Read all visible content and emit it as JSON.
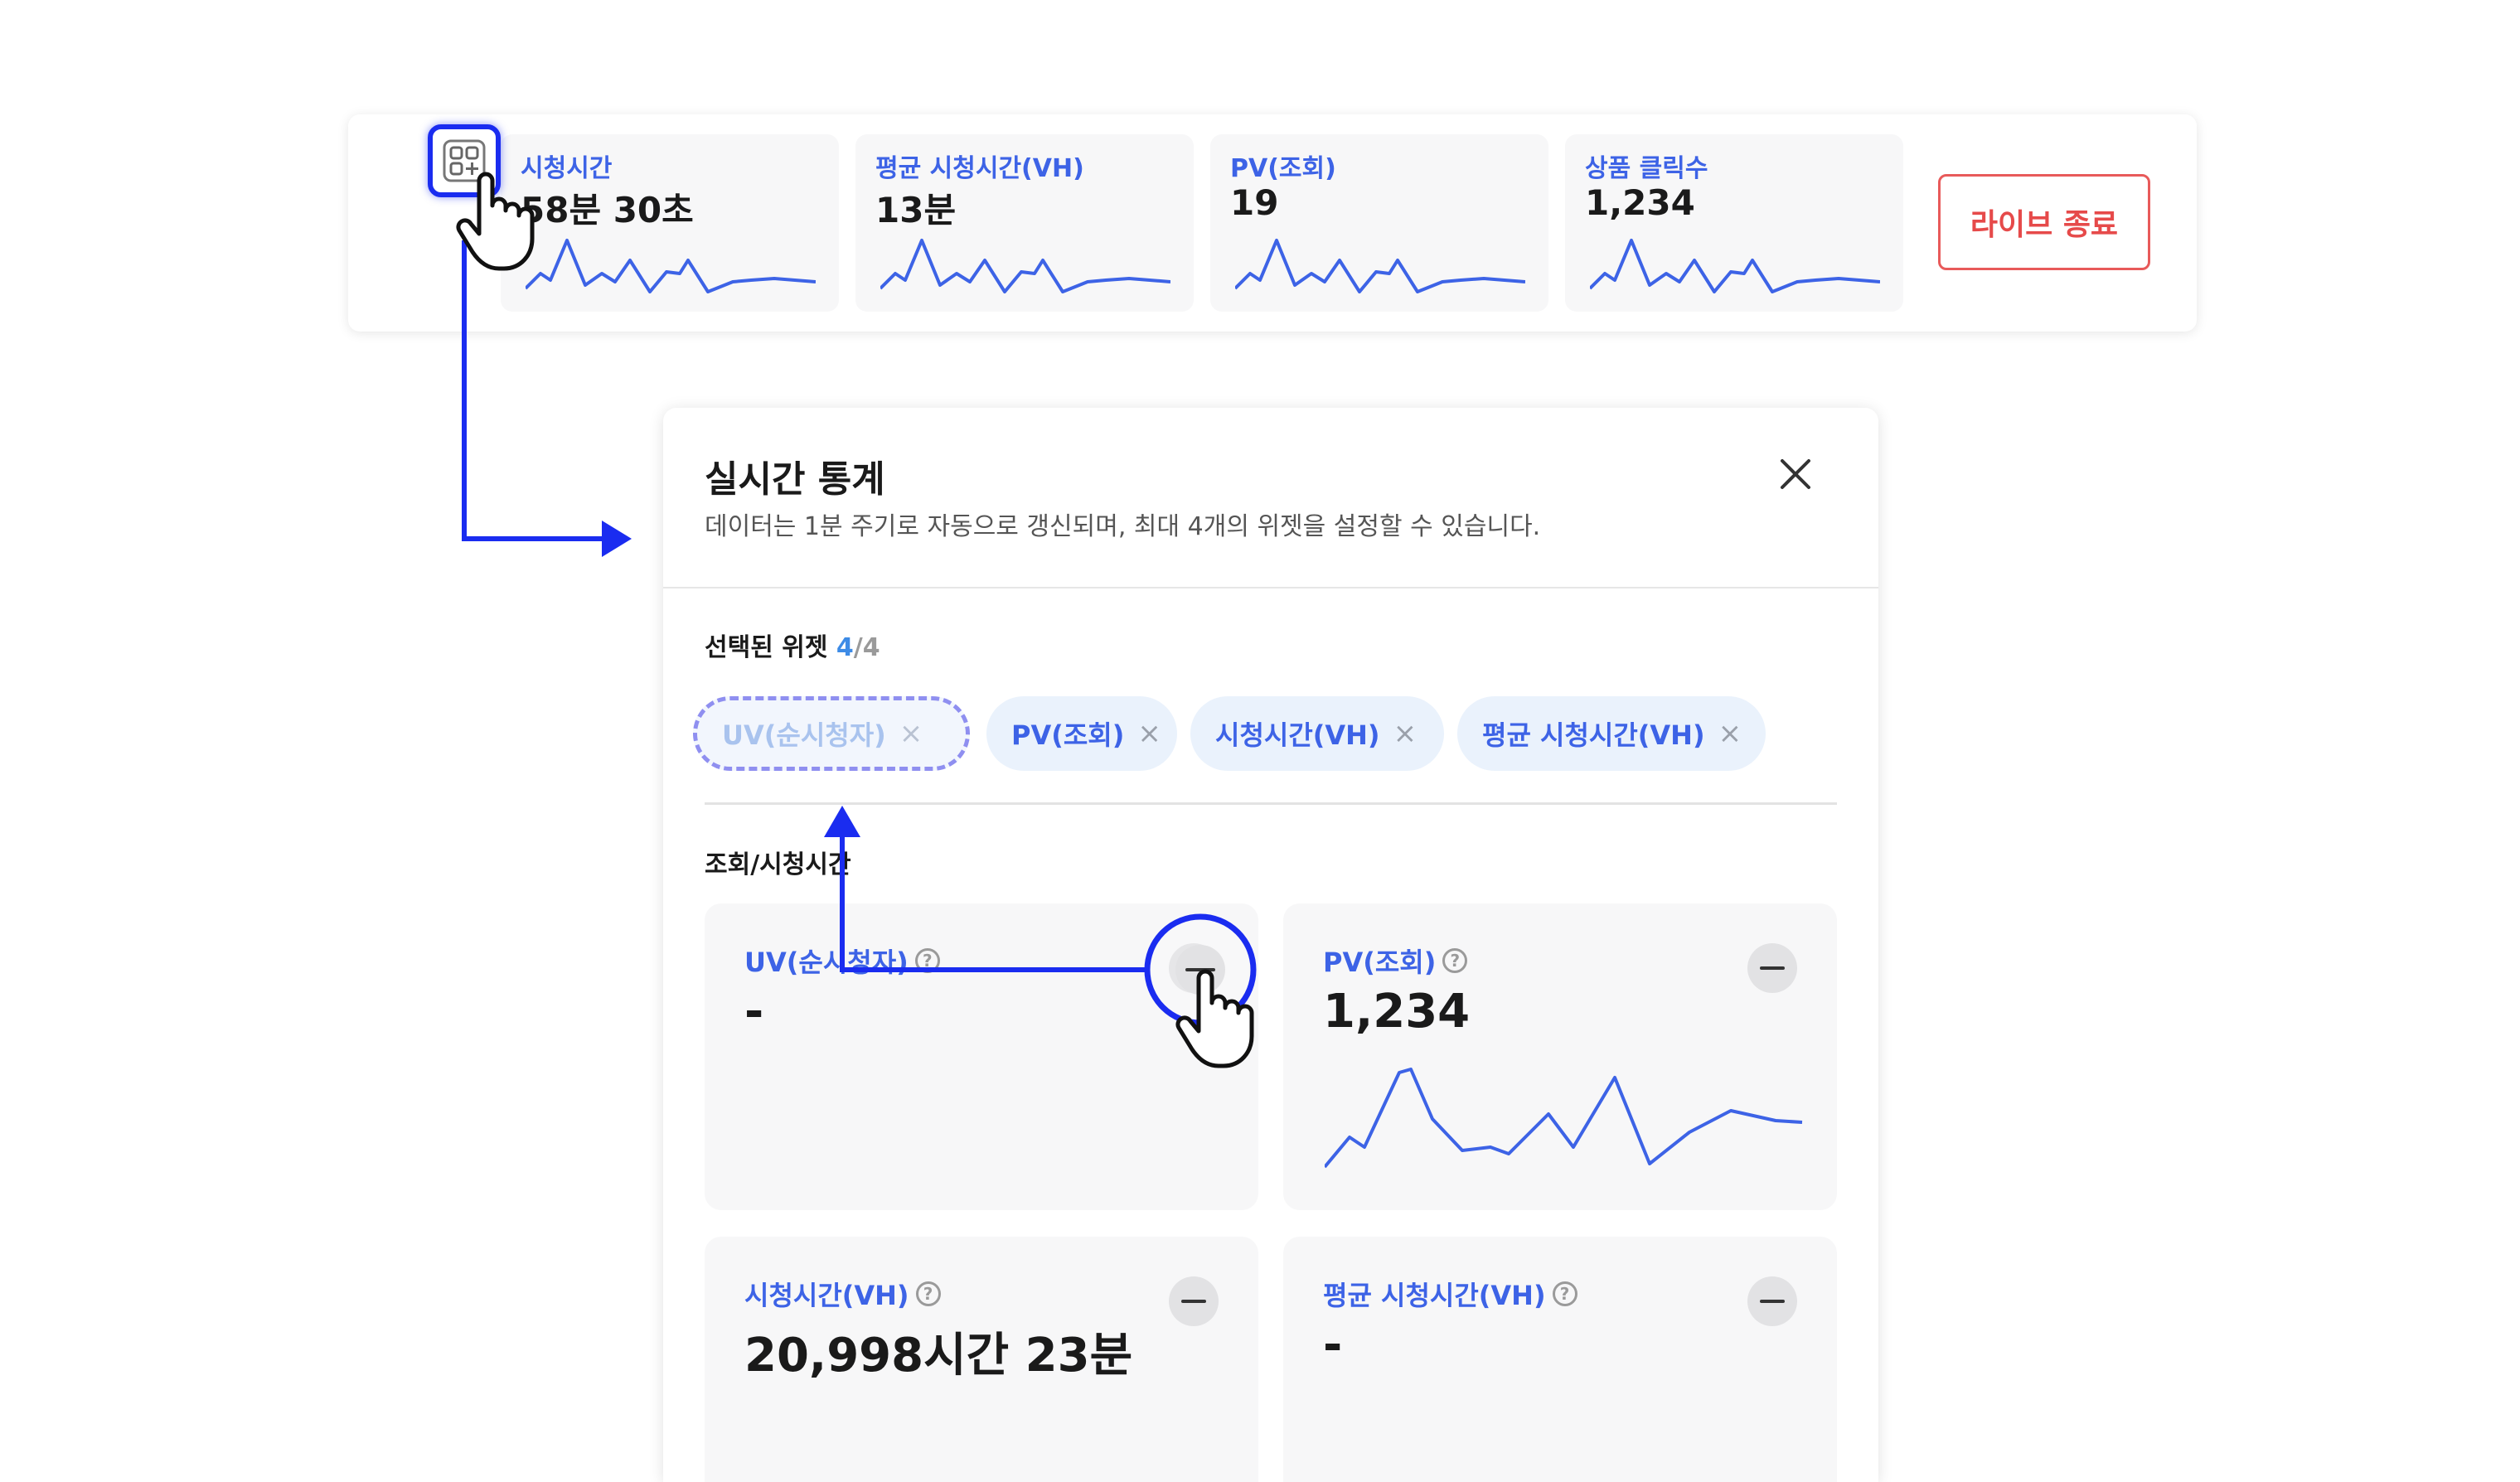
{
  "top_bar": {
    "metrics": [
      {
        "label": "시청시간",
        "value": "58분 30초"
      },
      {
        "label": "평균 시청시간(VH)",
        "value": "13분"
      },
      {
        "label": "PV(조회)",
        "value": "19"
      },
      {
        "label": "상품 클릭수",
        "value": "1,234"
      }
    ],
    "end_live_label": "라이브 종료",
    "widget_button_icon": "widget-add-icon"
  },
  "modal": {
    "title": "실시간 통계",
    "subtitle": "데이터는 1분 주기로 자동으로 갱신되며, 최대 4개의 위젯을 설정할 수 있습니다.",
    "selected": {
      "label": "선택된 위젯",
      "count": "4",
      "sep_total": "/4"
    },
    "chips": [
      {
        "label": "UV(순시청자)",
        "x": "×"
      },
      {
        "label": "PV(조회)",
        "x": "×"
      },
      {
        "label": "시청시간(VH)",
        "x": "×"
      },
      {
        "label": "평균 시청시간(VH)",
        "x": "×"
      }
    ],
    "section_title": "조회/시청시간",
    "widgets": [
      {
        "label": "UV(순시청자)",
        "value": "-",
        "help": "?"
      },
      {
        "label": "PV(조회)",
        "value": "1,234",
        "help": "?"
      },
      {
        "label": "시청시간(VH)",
        "value": "20,998시간 23분",
        "help": "?"
      },
      {
        "label": "평균 시청시간(VH)",
        "value": "-",
        "help": "?"
      }
    ]
  },
  "colors": {
    "accent": "#3d63e6",
    "annotation": "#1a2cf0",
    "danger": "#e64a4a",
    "chip_bg": "#eaf2fc"
  }
}
